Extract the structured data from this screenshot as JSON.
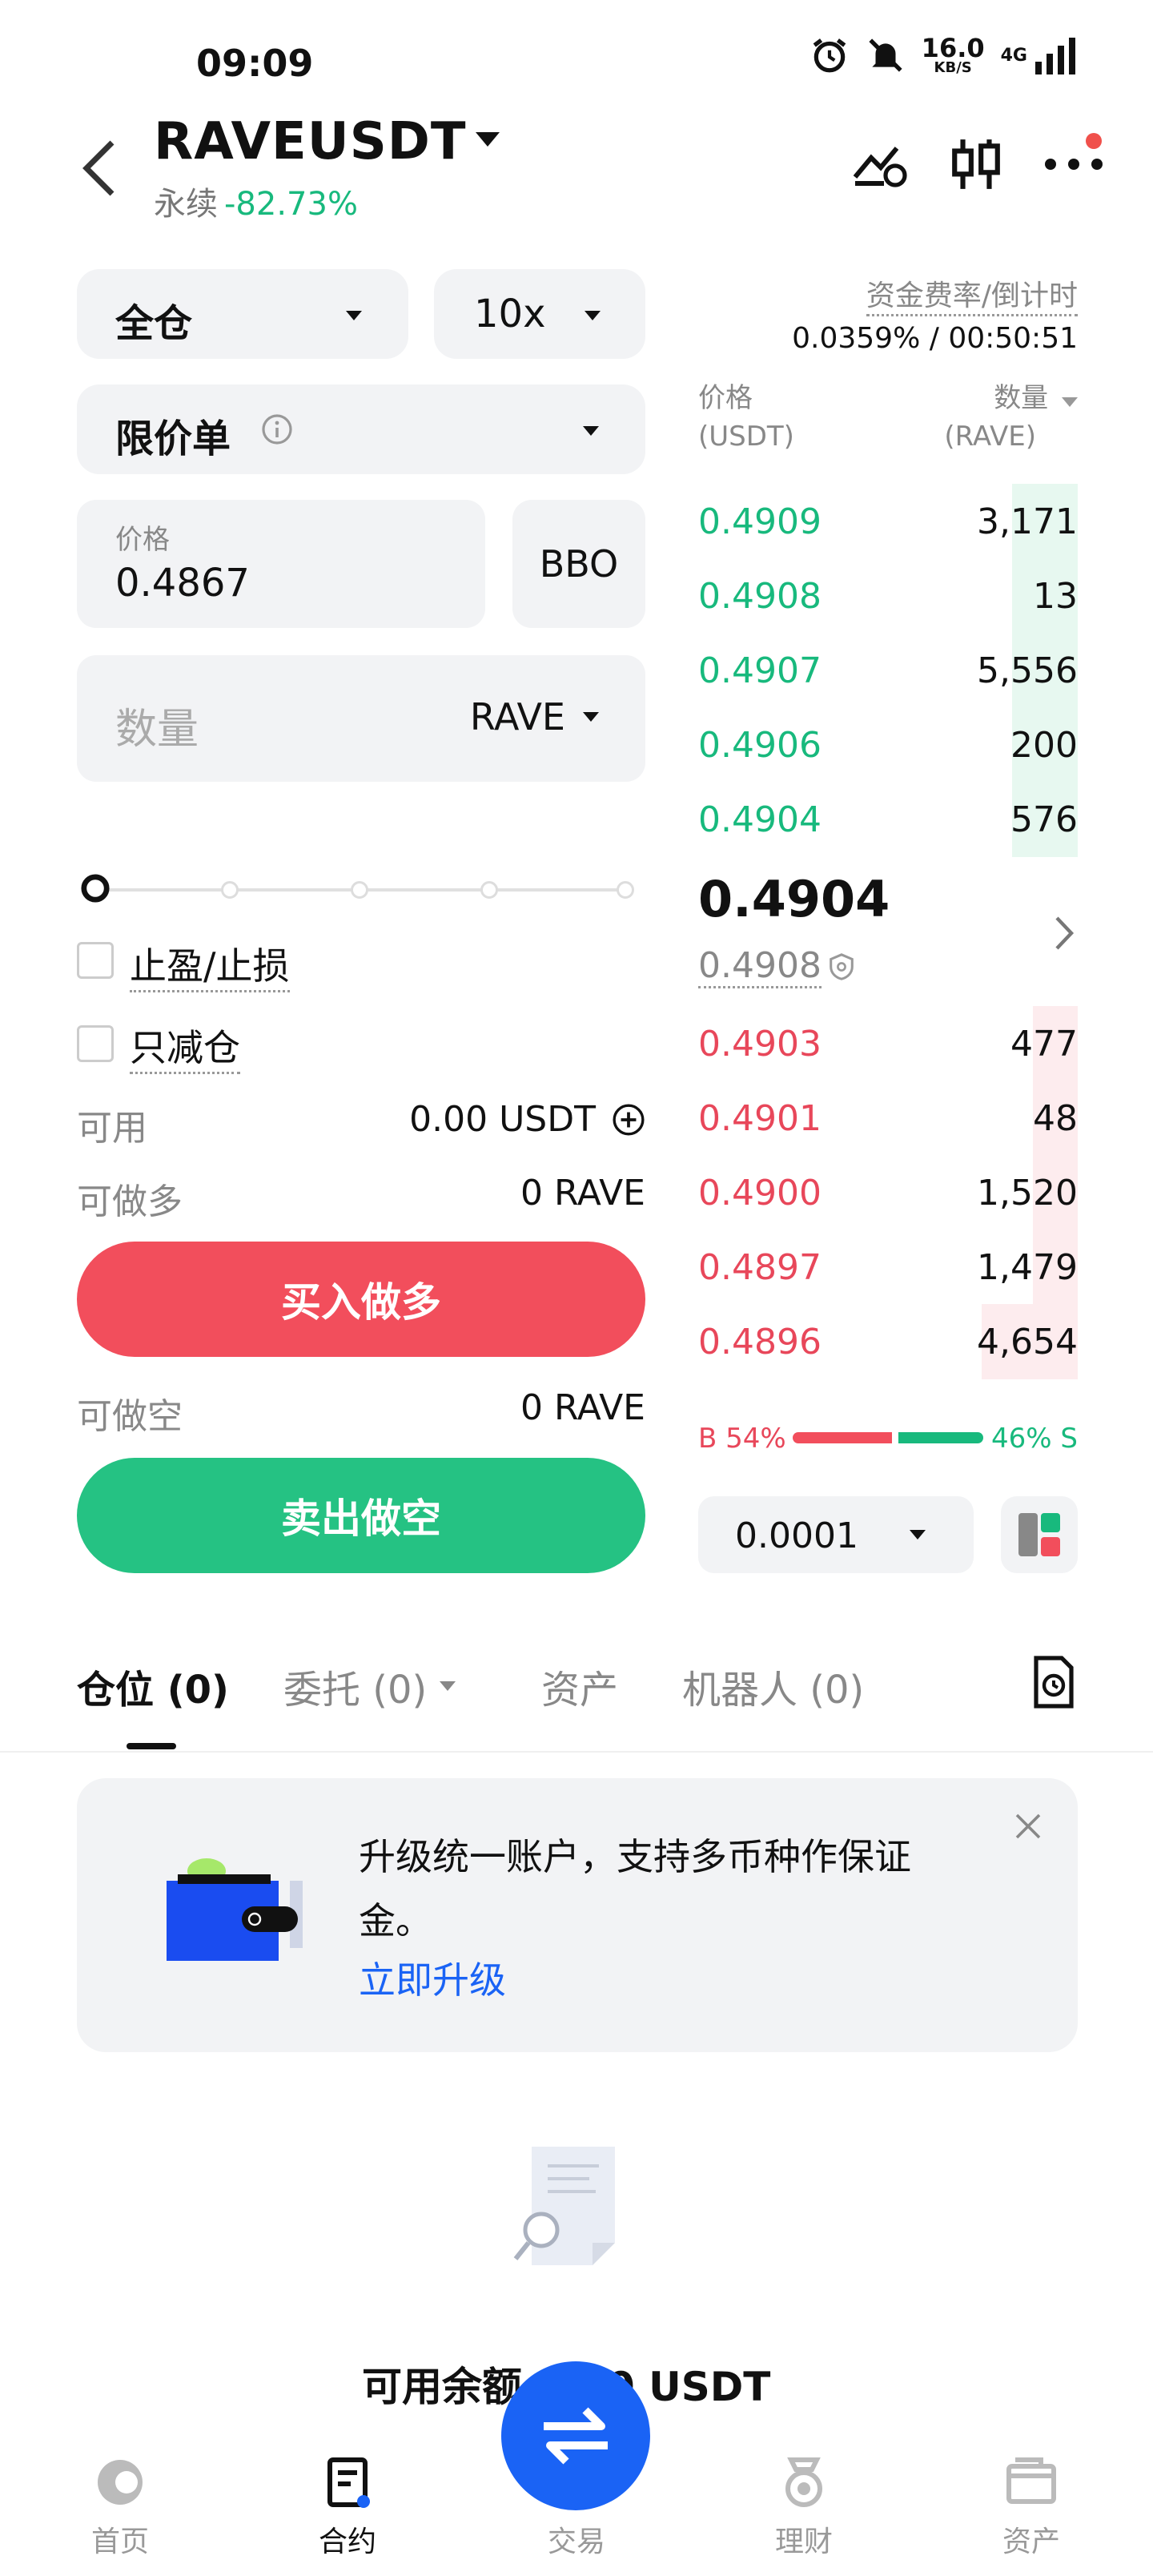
{
  "status": {
    "time": "09:09",
    "net_speed": "16.0",
    "net_unit": "KB/S",
    "signal": "4G"
  },
  "header": {
    "symbol": "RAVEUSDT",
    "type": "永续",
    "change": "-82.73%"
  },
  "form": {
    "margin_mode": "全仓",
    "leverage": "10x",
    "order_type": "限价单",
    "price_label": "价格",
    "price_value": "0.4867",
    "bbo_label": "BBO",
    "qty_placeholder": "数量",
    "qty_unit": "RAVE",
    "tpsl_label": "止盈/止损",
    "reduce_only_label": "只减仓",
    "available_label": "可用",
    "available_value": "0.00 USDT",
    "can_long_label": "可做多",
    "can_long_value": "0 RAVE",
    "buy_label": "买入做多",
    "can_short_label": "可做空",
    "can_short_value": "0 RAVE",
    "sell_label": "卖出做空"
  },
  "funding": {
    "label": "资金费率/倒计时",
    "value": "0.0359% / 00:50:51"
  },
  "orderbook": {
    "price_header": "价格",
    "price_unit": "(USDT)",
    "qty_header": "数量",
    "qty_unit": "(RAVE)",
    "bids_top": [
      {
        "price": "0.4909",
        "qty": "3,171",
        "depth": 0.08
      },
      {
        "price": "0.4908",
        "qty": "13",
        "depth": 0.08
      },
      {
        "price": "0.4907",
        "qty": "5,556",
        "depth": 0.08
      },
      {
        "price": "0.4906",
        "qty": "200",
        "depth": 0.06
      },
      {
        "price": "0.4904",
        "qty": "576",
        "depth": 0.06
      }
    ],
    "last_price": "0.4904",
    "mark_price": "0.4908",
    "asks_bottom": [
      {
        "price": "0.4903",
        "qty": "477",
        "depth": 0.05
      },
      {
        "price": "0.4901",
        "qty": "48",
        "depth": 0.05
      },
      {
        "price": "0.4900",
        "qty": "1,520",
        "depth": 0.05
      },
      {
        "price": "0.4897",
        "qty": "1,479",
        "depth": 0.05
      },
      {
        "price": "0.4896",
        "qty": "4,654",
        "depth": 0.12
      }
    ],
    "buy_ratio": "B 54%",
    "sell_ratio": "46% S",
    "buy_fraction": 0.54,
    "tick_size": "0.0001"
  },
  "tabs": [
    "仓位 (0)",
    "委托 (0)",
    "资产",
    "机器人 (0)"
  ],
  "banner": {
    "text": "升级统一账户，支持多币种作保证金。",
    "link": "立即升级"
  },
  "empty": {
    "text": "可用余额 0.00 USDT"
  },
  "nav": [
    "首页",
    "合约",
    "交易",
    "理财",
    "资产"
  ],
  "colors": {
    "green": "#18b97d",
    "red": "#e8475a",
    "accent": "#1a63f5"
  }
}
